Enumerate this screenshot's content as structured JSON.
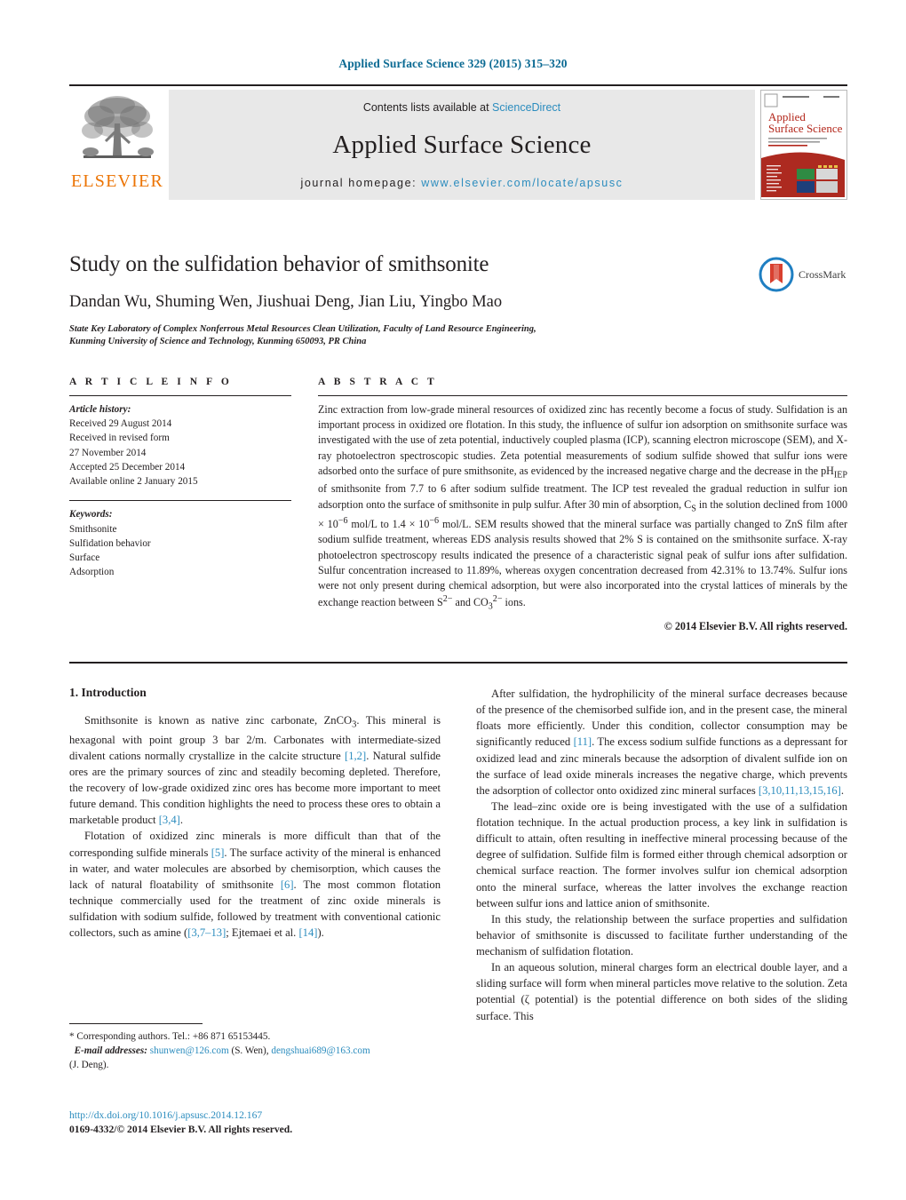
{
  "running_head": "Applied Surface Science 329 (2015) 315–320",
  "masthead": {
    "publisher_logo_text": "ELSEVIER",
    "contents_prefix": "Contents lists available at ",
    "contents_link": "ScienceDirect",
    "journal_title": "Applied Surface Science",
    "homepage_prefix": "journal homepage: ",
    "homepage_url": "www.elsevier.com/locate/apsusc",
    "cover_title_line1": "Applied",
    "cover_title_line2": "Surface Science"
  },
  "title_block": {
    "title": "Study on the sulfidation behavior of smithsonite",
    "authors": "Dandan Wu, Shuming Wen, Jiushuai Deng, Jian Liu, Yingbo Mao",
    "affiliation_line1": "State Key Laboratory of Complex Nonferrous Metal Resources Clean Utilization, Faculty of Land Resource Engineering,",
    "affiliation_line2": "Kunming University of Science and Technology, Kunming 650093, PR China",
    "crossmark_label": "CrossMark"
  },
  "article_info": {
    "heading": "A R T I C L E   I N F O",
    "history_label": "Article history:",
    "history": [
      "Received 29 August 2014",
      "Received in revised form",
      "27 November 2014",
      "Accepted 25 December 2014",
      "Available online 2 January 2015"
    ],
    "keywords_label": "Keywords:",
    "keywords": [
      "Smithsonite",
      "Sulfidation behavior",
      "Surface",
      "Adsorption"
    ]
  },
  "abstract": {
    "heading": "A B S T R A C T",
    "text": "Zinc extraction from low-grade mineral resources of oxidized zinc has recently become a focus of study. Sulfidation is an important process in oxidized ore flotation. In this study, the influence of sulfur ion adsorption on smithsonite surface was investigated with the use of zeta potential, inductively coupled plasma (ICP), scanning electron microscope (SEM), and X-ray photoelectron spectroscopic studies. Zeta potential measurements of sodium sulfide showed that sulfur ions were adsorbed onto the surface of pure smithsonite, as evidenced by the increased negative charge and the decrease in the pH",
    "text_iep": "IEP",
    "text_2": " of smithsonite from 7.7 to 6 after sodium sulfide treatment. The ICP test revealed the gradual reduction in sulfur ion adsorption onto the surface of smithsonite in pulp sulfur. After 30 min of absorption, C",
    "text_cs": "S",
    "text_3": " in the solution declined from 1000 × 10",
    "exp1": "−6",
    "text_4": " mol/L to 1.4 × 10",
    "exp2": "−6",
    "text_5": " mol/L. SEM results showed that the mineral surface was partially changed to ZnS film after sodium sulfide treatment, whereas EDS analysis results showed that 2% S is contained on the smithsonite surface. X-ray photoelectron spectroscopy results indicated the presence of a characteristic signal peak of sulfur ions after sulfidation. Sulfur concentration increased to 11.89%, whereas oxygen concentration decreased from 42.31% to 13.74%. Sulfur ions were not only present during chemical adsorption, but were also incorporated into the crystal lattices of minerals by the exchange reaction between S",
    "sup_s": "2−",
    "text_6": " and CO",
    "sub_co3": "3",
    "sup_co3": "2−",
    "text_7": " ions.",
    "copyright": "© 2014 Elsevier B.V. All rights reserved."
  },
  "body": {
    "section_1_heading": "1.  Introduction",
    "left_para_1_a": "Smithsonite is known as native zinc carbonate, ZnCO",
    "left_para_1_sub": "3",
    "left_para_1_b": ". This mineral is hexagonal with point group 3 bar 2/m. Carbonates with intermediate-sized divalent cations normally crystallize in the calcite structure ",
    "left_para_1_ref1": "[1,2]",
    "left_para_1_c": ". Natural sulfide ores are the primary sources of zinc and steadily becoming depleted. Therefore, the recovery of low-grade oxidized zinc ores has become more important to meet future demand. This condition highlights the need to process these ores to obtain a marketable product ",
    "left_para_1_ref2": "[3,4]",
    "left_para_1_d": ".",
    "left_para_2_a": "Flotation of oxidized zinc minerals is more difficult than that of the corresponding sulfide minerals ",
    "left_para_2_ref1": "[5]",
    "left_para_2_b": ". The surface activity of the mineral is enhanced in water, and water molecules are absorbed by chemisorption, which causes the lack of natural floatability of smithsonite ",
    "left_para_2_ref2": "[6]",
    "left_para_2_c": ". The most common flotation technique commercially used for the treatment of zinc oxide minerals is sulfidation with sodium sulfide, followed by treatment with conventional cationic collectors, such as amine (",
    "left_para_2_ref3": "[3,7–13]",
    "left_para_2_d": "; Ejtemaei et al. ",
    "left_para_2_ref4": "[14]",
    "left_para_2_e": ").",
    "right_para_1_a": "After sulfidation, the hydrophilicity of the mineral surface decreases because of the presence of the chemisorbed sulfide ion, and in the present case, the mineral floats more efficiently. Under this condition, collector consumption may be significantly reduced ",
    "right_para_1_ref1": "[11]",
    "right_para_1_b": ". The excess sodium sulfide functions as a depressant for oxidized lead and zinc minerals because the adsorption of divalent sulfide ion on the surface of lead oxide minerals increases the negative charge, which prevents the adsorption of collector onto oxidized zinc mineral surfaces ",
    "right_para_1_ref2": "[3,10,11,13,15,16]",
    "right_para_1_c": ".",
    "right_para_2": "The lead–zinc oxide ore is being investigated with the use of a sulfidation flotation technique. In the actual production process, a key link in sulfidation is difficult to attain, often resulting in ineffective mineral processing because of the degree of sulfidation. Sulfide film is formed either through chemical adsorption or chemical surface reaction. The former involves sulfur ion chemical adsorption onto the mineral surface, whereas the latter involves the exchange reaction between sulfur ions and lattice anion of smithsonite.",
    "right_para_3": "In this study, the relationship between the surface properties and sulfidation behavior of smithsonite is discussed to facilitate further understanding of the mechanism of sulfidation flotation.",
    "right_para_4": "In an aqueous solution, mineral charges form an electrical double layer, and a sliding surface will form when mineral particles move relative to the solution. Zeta potential (ζ potential) is the potential difference on both sides of the sliding surface. This"
  },
  "footnote": {
    "corresponding": "* Corresponding authors. Tel.: +86 871 65153445.",
    "email_label": "E-mail addresses:",
    "email_1": "shunwen@126.com",
    "email_1_who": "(S. Wen),",
    "email_2": "dengshuai689@163.com",
    "email_2_who": "(J. Deng)."
  },
  "imprint": {
    "doi": "http://dx.doi.org/10.1016/j.apsusc.2014.12.167",
    "issn": "0169-4332/© 2014 Elsevier B.V. All rights reserved."
  }
}
